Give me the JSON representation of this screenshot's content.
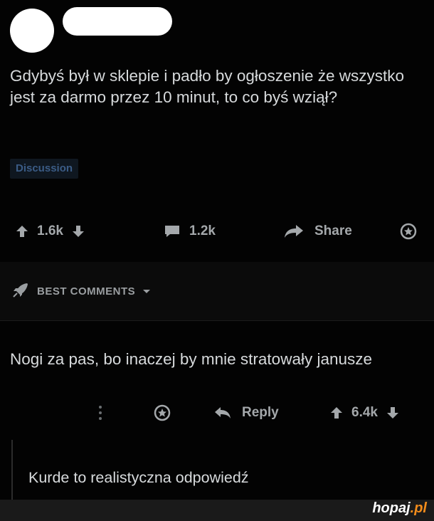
{
  "post": {
    "title": "Gdybyś był w sklepie i padło by ogłoszenie że wszystko jest za darmo przez 10 minut, to co byś wziął?",
    "flair": "Discussion",
    "votes": "1.6k",
    "comments": "1.2k",
    "share_label": "Share"
  },
  "sort": {
    "label": "BEST COMMENTS"
  },
  "comment": {
    "text": "Nogi za pas, bo inaczej by mnie stratowały janusze",
    "reply_label": "Reply",
    "votes": "6.4k"
  },
  "reply": {
    "text": "Kurde to realistyczna odpowiedź"
  },
  "watermark": {
    "name": "hopaj",
    "tld": ".pl"
  },
  "colors": {
    "background": "#030303",
    "text": "#d7dadc",
    "muted": "#a4a8ab",
    "flair_text": "#3b5c86",
    "watermark_accent": "#f28c1b"
  }
}
